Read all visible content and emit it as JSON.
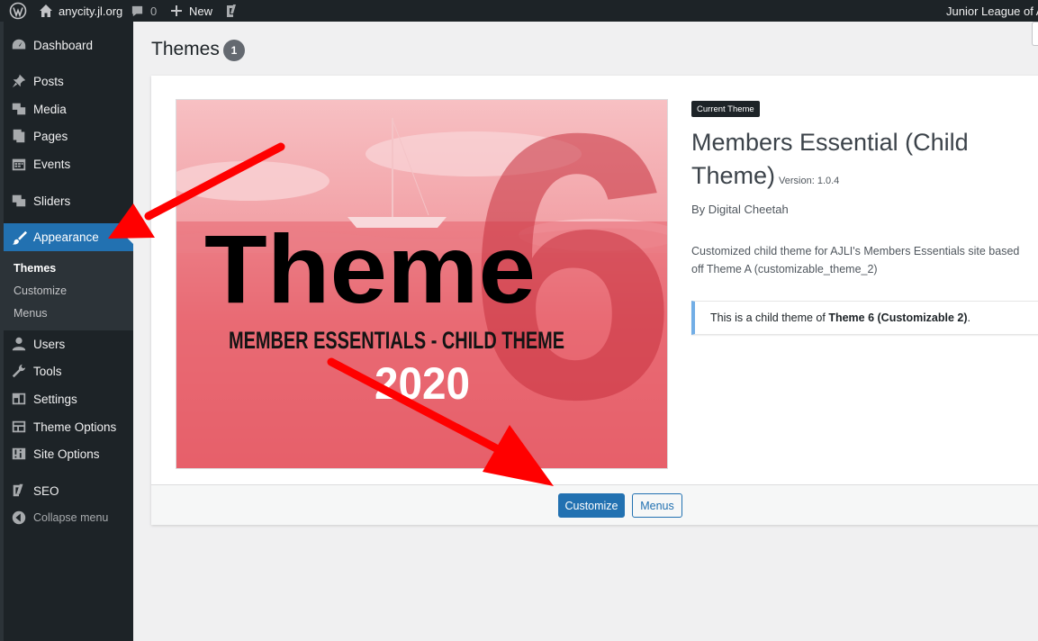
{
  "admin_bar": {
    "site_name": "anycity.jl.org",
    "comments_count": "0",
    "new_label": "New",
    "account_text": "Junior League of An"
  },
  "sidebar": {
    "items": [
      {
        "label": "Dashboard",
        "icon": "dashboard-icon"
      },
      {
        "label": "Posts",
        "icon": "pin-icon"
      },
      {
        "label": "Media",
        "icon": "media-icon"
      },
      {
        "label": "Pages",
        "icon": "pages-icon"
      },
      {
        "label": "Events",
        "icon": "calendar-icon"
      },
      {
        "label": "Sliders",
        "icon": "slides-icon"
      },
      {
        "label": "Appearance",
        "icon": "brush-icon"
      },
      {
        "label": "Users",
        "icon": "user-icon"
      },
      {
        "label": "Tools",
        "icon": "wrench-icon"
      },
      {
        "label": "Settings",
        "icon": "settings-icon"
      },
      {
        "label": "Theme Options",
        "icon": "layout-icon"
      },
      {
        "label": "Site Options",
        "icon": "sliders-icon"
      },
      {
        "label": "SEO",
        "icon": "yoast-icon"
      }
    ],
    "submenu": [
      "Themes",
      "Customize",
      "Menus"
    ],
    "collapse_label": "Collapse menu"
  },
  "main": {
    "title": "Themes",
    "count": "1"
  },
  "theme": {
    "badge": "Current Theme",
    "name": "Members Essential (Child Theme)",
    "version": "Version: 1.0.4",
    "author": "By Digital Cheetah",
    "description_line1": "Customized child theme for AJLI's Members Essentials site based",
    "description_line2": "off Theme A (customizable_theme_2)",
    "notice_prefix": "This is a child theme of ",
    "notice_parent": "Theme 6 (Customizable 2)",
    "notice_suffix": ".",
    "screenshot": {
      "big_word": "Theme",
      "big_number": "6",
      "subtitle": "MEMBER ESSENTIALS - CHILD THEME",
      "year": "2020"
    }
  },
  "actions": {
    "customize_label": "Customize",
    "menus_label": "Menus"
  },
  "colors": {
    "sidebar_bg": "#1d2327",
    "accent": "#2271b1",
    "annotation_arrow": "#ff0000"
  }
}
